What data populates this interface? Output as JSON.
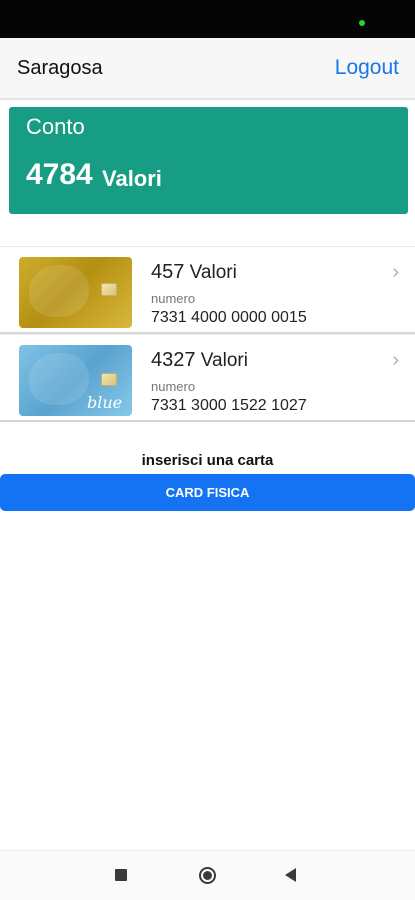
{
  "header": {
    "title": "Saragosa",
    "logout_label": "Logout"
  },
  "account": {
    "label": "Conto",
    "amount": "4784",
    "unit": "Valori"
  },
  "cards": [
    {
      "amount": "457",
      "unit": "Valori",
      "number_label": "numero",
      "number": "7331 4000 0000 0015",
      "style": "gold"
    },
    {
      "amount": "4327",
      "unit": "Valori",
      "number_label": "numero",
      "number": "7331 3000 1522 1027",
      "style": "blue",
      "card_text": "blue"
    }
  ],
  "insert": {
    "label": "inserisci una carta",
    "button_label": "CARD FISICA"
  },
  "colors": {
    "accent_blue": "#1877e6",
    "account_green": "#169d83",
    "button_blue": "#1473f2"
  },
  "icons": {
    "chevron": "chevron-right-icon",
    "nav_recents": "square-icon",
    "nav_home": "circle-icon",
    "nav_back": "triangle-back-icon"
  }
}
